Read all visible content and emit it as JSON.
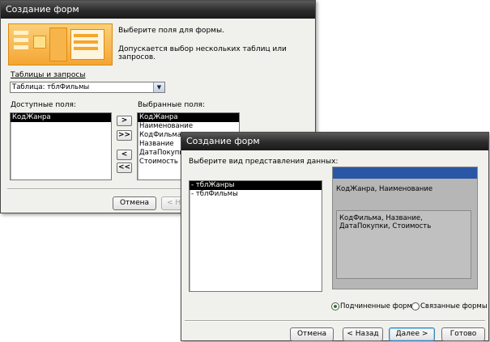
{
  "back_window": {
    "title": "Создание форм",
    "prompt": "Выберите поля для формы.",
    "note": "Допускается выбор нескольких таблиц или запросов.",
    "tables_label": "Таблицы и запросы",
    "tables_value": "Таблица: тблФильмы",
    "available_label": "Доступные поля:",
    "available_fields": [
      "КодЖанра"
    ],
    "selected_label": "Выбранные поля:",
    "selected_fields": [
      "КодЖанра",
      "Наименование",
      "КодФильма",
      "Название",
      "ДатаПокупки",
      "Стоимость"
    ],
    "move_one": ">",
    "move_all": ">>",
    "remove_one": "<",
    "remove_all": "<<",
    "cancel": "Отмена",
    "back_partial": "< Н"
  },
  "front_window": {
    "title": "Создание форм",
    "prompt": "Выберите вид представления данных:",
    "views": [
      "- тблЖанры",
      "- тблФильмы"
    ],
    "preview_field1": "КодЖанра, Наименование",
    "preview_field2": "КодФильма, Название, ДатаПокупки, Стоимость",
    "radio_sub": "Подчиненные формы",
    "radio_linked": "Связанные формы",
    "cancel": "Отмена",
    "back": "< Назад",
    "next": "Далее >",
    "finish": "Готово"
  },
  "colors": {
    "selection": "#000000",
    "preview_header": "#2a56a6",
    "wizard_orange": "#f39a1e"
  },
  "icons": {
    "dropdown": "chevron-down-icon",
    "banner": "wizard-banner-icon"
  }
}
